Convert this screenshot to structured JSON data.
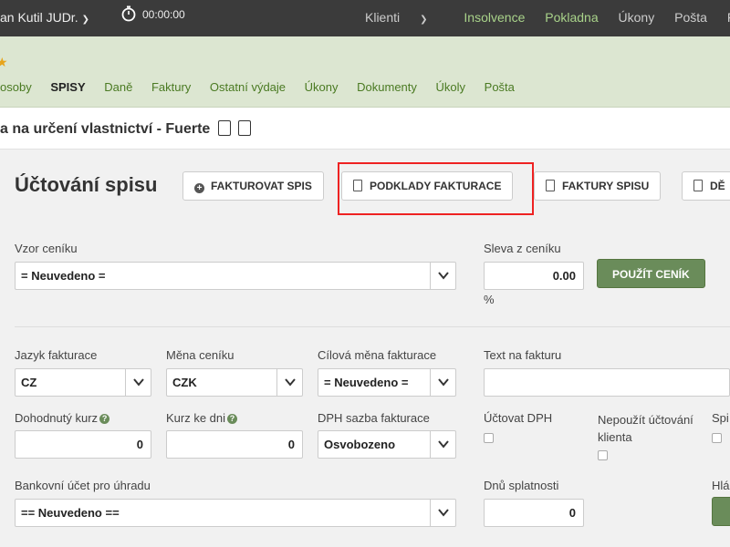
{
  "topbar": {
    "user": "an Kutil JUDr.",
    "timer": "00:00:00",
    "nav": [
      "Klienti",
      "Insolvence",
      "Pokladna",
      "Úkony",
      "Pošta",
      "Fa"
    ]
  },
  "tabs": [
    "osoby",
    "SPISY",
    "Daně",
    "Faktury",
    "Ostatní výdaje",
    "Úkony",
    "Dokumenty",
    "Úkoly",
    "Pošta"
  ],
  "case_title": "a na určení vlastnictví - Fuerte",
  "page_title": "Účtování spisu",
  "buttons": {
    "invoice_case": "FAKTUROVAT SPIS",
    "billing_docs": "PODKLADY FAKTURACE",
    "case_invoices": "FAKTURY SPISU",
    "more": "DĚ"
  },
  "form": {
    "price_template_label": "Vzor ceníku",
    "price_template_value": "= Neuvedeno =",
    "discount_label": "Sleva z ceníku",
    "discount_value": "0.00",
    "discount_unit": "%",
    "apply_price_list": "POUŽÍT CENÍK",
    "language_label": "Jazyk fakturace",
    "language_value": "CZ",
    "currency_label": "Měna ceníku",
    "currency_value": "CZK",
    "target_currency_label": "Cílová měna fakturace",
    "target_currency_value": "= Neuvedeno =",
    "invoice_text_label": "Text na fakturu",
    "invoice_text_value": "",
    "agreed_rate_label": "Dohodnutý kurz",
    "agreed_rate_value": "0",
    "rate_date_label": "Kurz ke dni",
    "rate_date_value": "0",
    "vat_rate_label": "DPH sazba fakturace",
    "vat_rate_value": "Osvobozeno",
    "charge_vat_label": "Účtovat DPH",
    "no_client_billing_label": "Nepoužít účtování klienta",
    "spi_label": "Spi",
    "bank_account_label": "Bankovní účet pro úhradu",
    "bank_account_value": "== Neuvedeno ==",
    "due_days_label": "Dnů splatnosti",
    "due_days_value": "0",
    "hla_label": "Hlá"
  }
}
